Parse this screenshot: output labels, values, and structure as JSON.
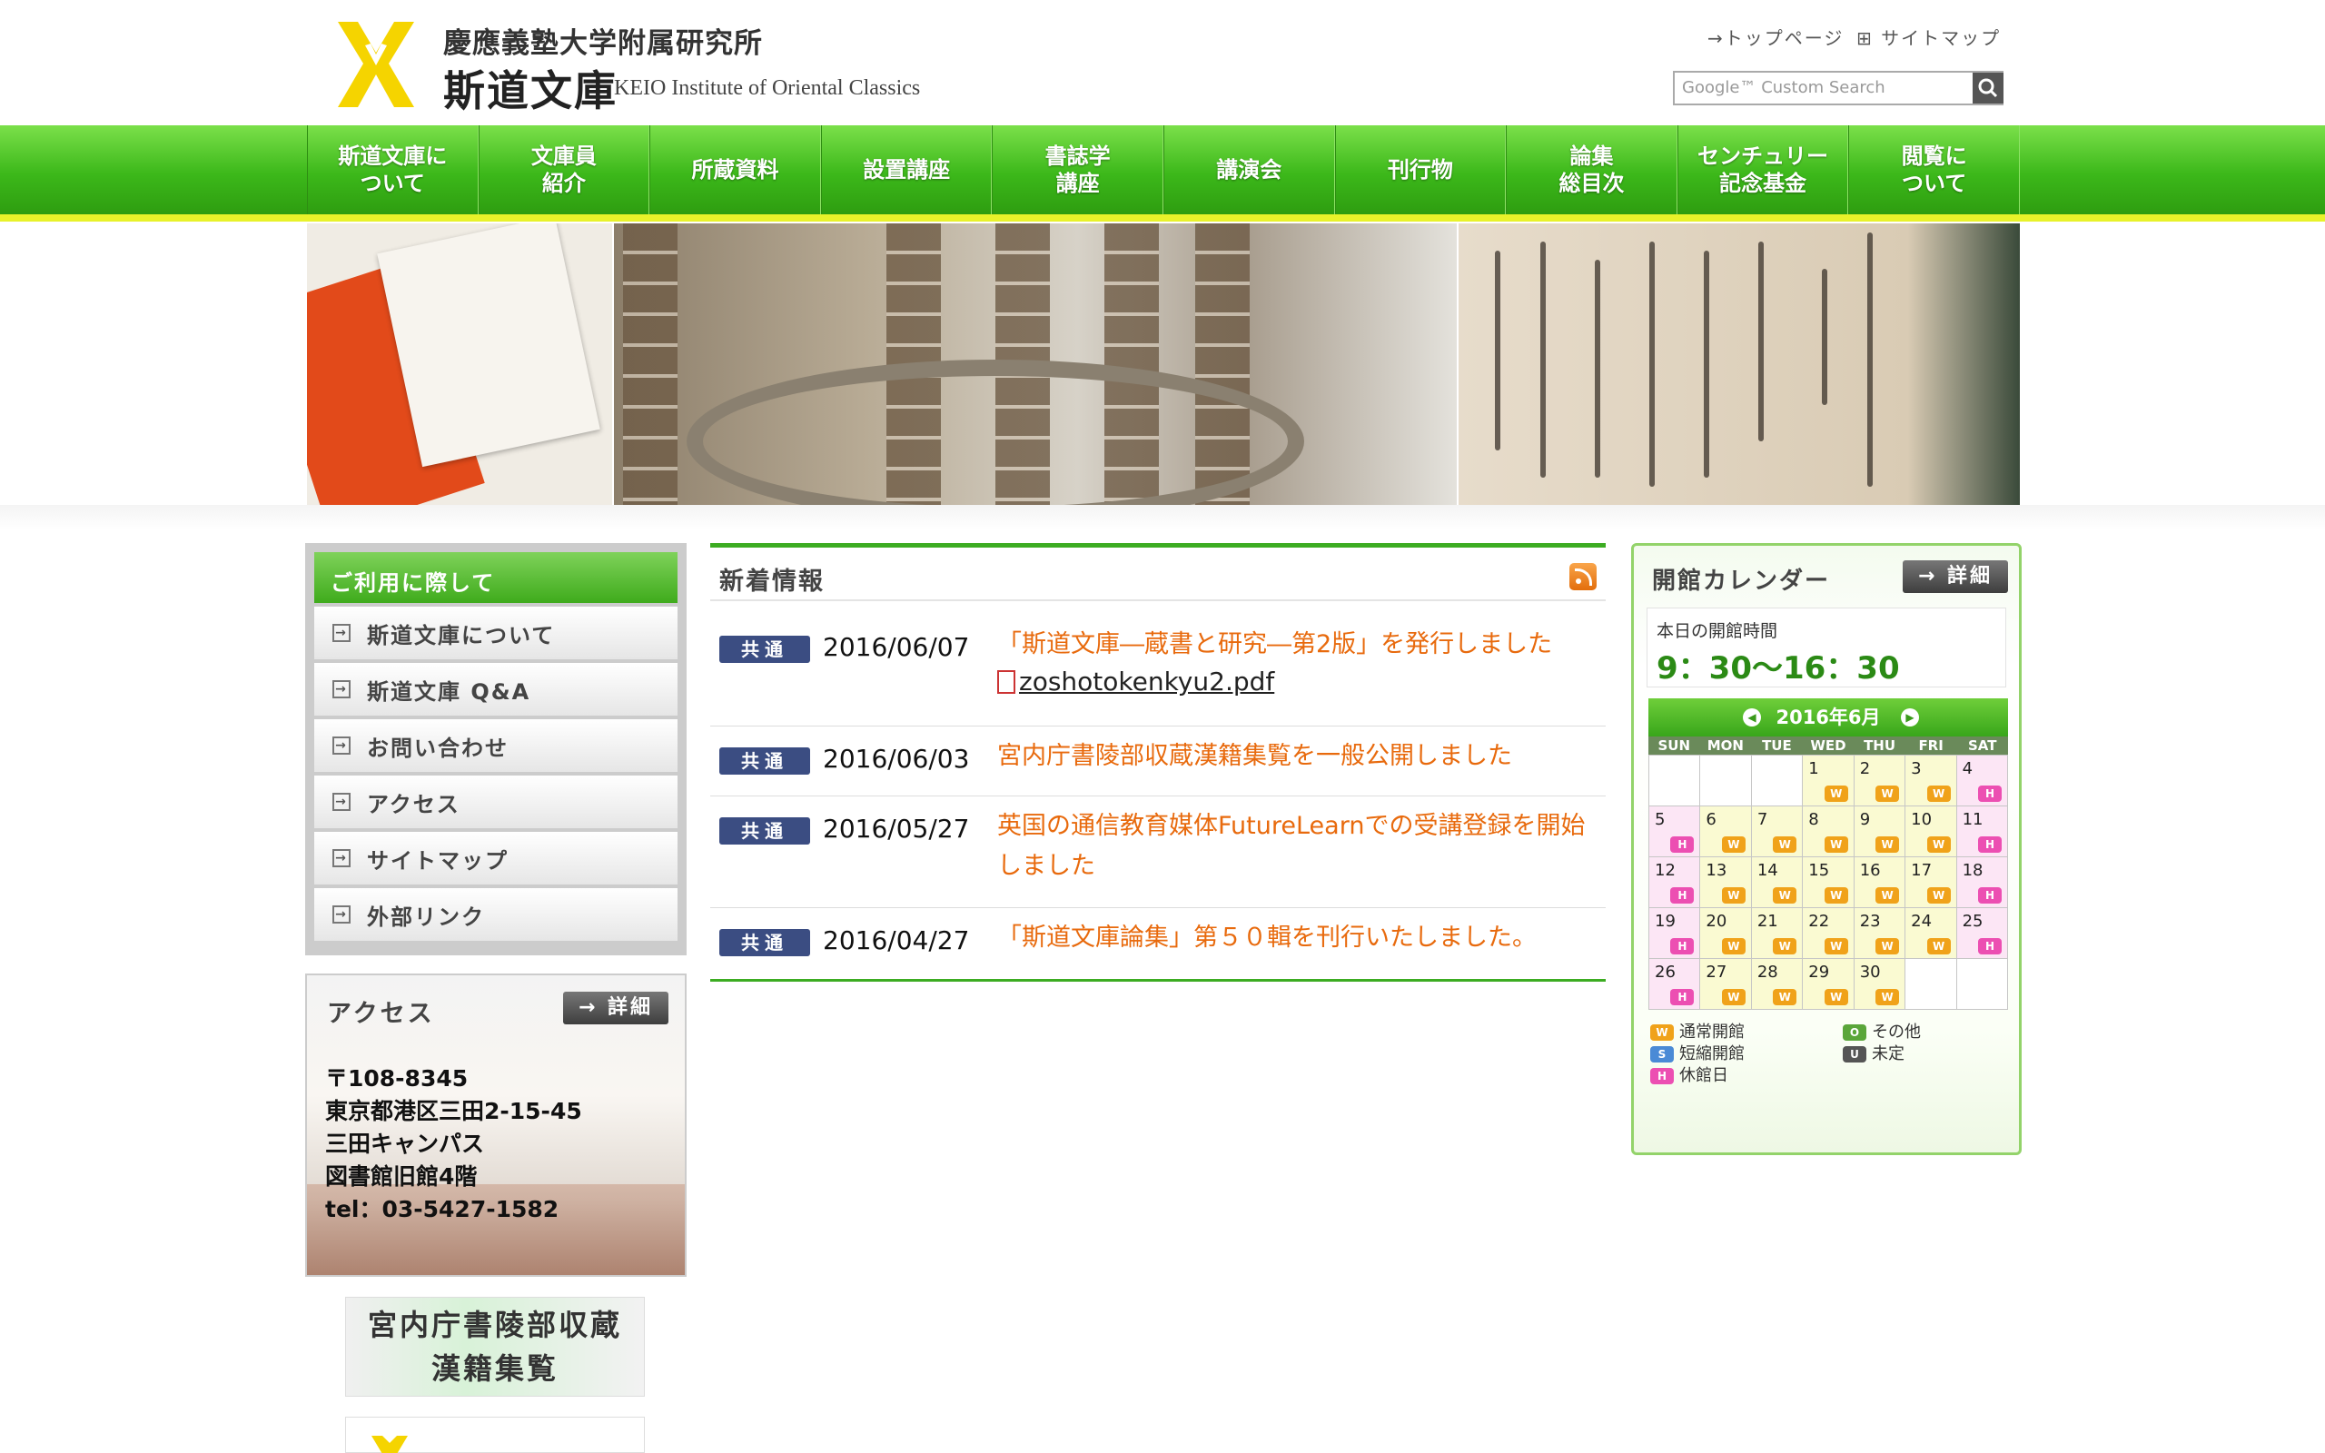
{
  "header": {
    "subtitle": "慶應義塾大学附属研究所",
    "title": "斯道文庫",
    "title_en": "KEIO Institute of Oriental Classics",
    "util_top": "トップページ",
    "util_sitemap": "サイトマップ",
    "search_placeholder": "Google™ Custom Search"
  },
  "nav": [
    "斯道文庫に\nついて",
    "文庫員\n紹介",
    "所蔵資料",
    "設置講座",
    "書誌学\n講座",
    "講演会",
    "刊行物",
    "論集\n総目次",
    "センチュリー\n記念基金",
    "閲覧に\nついて"
  ],
  "usage": {
    "title": "ご利用に際して",
    "items": [
      "斯道文庫について",
      "斯道文庫 Q&A",
      "お問い合わせ",
      "アクセス",
      "サイトマップ",
      "外部リンク"
    ]
  },
  "access": {
    "title": "アクセス",
    "detail_label": "詳細",
    "lines": [
      "〒108-8345",
      "東京都港区三田2-15-45",
      "三田キャンパス",
      "図書館旧館4階",
      "tel：03-5427-1582"
    ]
  },
  "side_banner": {
    "line1": "宮内庁書陵部収蔵",
    "line2": "漢籍集覧"
  },
  "news": {
    "title": "新着情報",
    "items": [
      {
        "tag": "共通",
        "date": "2016/06/07",
        "text": "「斯道文庫―蔵書と研究―第2版」を発行しました",
        "attachment": "zoshotokenkyu2.pdf"
      },
      {
        "tag": "共通",
        "date": "2016/06/03",
        "text": "宮内庁書陵部収蔵漢籍集覧を一般公開しました"
      },
      {
        "tag": "共通",
        "date": "2016/05/27",
        "text": "英国の通信教育媒体FutureLearnでの受講登録を開始しました"
      },
      {
        "tag": "共通",
        "date": "2016/04/27",
        "text": "「斯道文庫論集」第５０輯を刊行いたしました。"
      }
    ]
  },
  "calendar": {
    "title": "開館カレンダー",
    "detail_label": "詳細",
    "hours_label": "本日の開館時間",
    "hours_value": "9：30〜16：30",
    "month_label": "2016年6月",
    "dows": [
      "SUN",
      "MON",
      "TUE",
      "WED",
      "THU",
      "FRI",
      "SAT"
    ],
    "days": [
      {
        "d": "",
        "s": ""
      },
      {
        "d": "",
        "s": ""
      },
      {
        "d": "",
        "s": ""
      },
      {
        "d": "1",
        "s": "W"
      },
      {
        "d": "2",
        "s": "W"
      },
      {
        "d": "3",
        "s": "W"
      },
      {
        "d": "4",
        "s": "H"
      },
      {
        "d": "5",
        "s": "H"
      },
      {
        "d": "6",
        "s": "W"
      },
      {
        "d": "7",
        "s": "W"
      },
      {
        "d": "8",
        "s": "W"
      },
      {
        "d": "9",
        "s": "W"
      },
      {
        "d": "10",
        "s": "W"
      },
      {
        "d": "11",
        "s": "H"
      },
      {
        "d": "12",
        "s": "H"
      },
      {
        "d": "13",
        "s": "W"
      },
      {
        "d": "14",
        "s": "W"
      },
      {
        "d": "15",
        "s": "W"
      },
      {
        "d": "16",
        "s": "W"
      },
      {
        "d": "17",
        "s": "W"
      },
      {
        "d": "18",
        "s": "H"
      },
      {
        "d": "19",
        "s": "H"
      },
      {
        "d": "20",
        "s": "W"
      },
      {
        "d": "21",
        "s": "W"
      },
      {
        "d": "22",
        "s": "W"
      },
      {
        "d": "23",
        "s": "W"
      },
      {
        "d": "24",
        "s": "W"
      },
      {
        "d": "25",
        "s": "H"
      },
      {
        "d": "26",
        "s": "H"
      },
      {
        "d": "27",
        "s": "W"
      },
      {
        "d": "28",
        "s": "W"
      },
      {
        "d": "29",
        "s": "W"
      },
      {
        "d": "30",
        "s": "W"
      },
      {
        "d": "",
        "s": ""
      },
      {
        "d": "",
        "s": ""
      }
    ],
    "legend": [
      {
        "key": "W",
        "label": "通常開館",
        "color": "#f0a21a"
      },
      {
        "key": "O",
        "label": "その他",
        "color": "#5aa63a"
      },
      {
        "key": "S",
        "label": "短縮開館",
        "color": "#4a8ad6"
      },
      {
        "key": "U",
        "label": "未定",
        "color": "#555555"
      },
      {
        "key": "H",
        "label": "休館日",
        "color": "#ec4fb2"
      }
    ]
  },
  "colors": {
    "nav_green": "#3cb81a",
    "nav_underline": "#e8f22a",
    "news_link": "#e86a0d",
    "tag_navy": "#3b4d82",
    "logo_yellow": "#f5d400"
  }
}
